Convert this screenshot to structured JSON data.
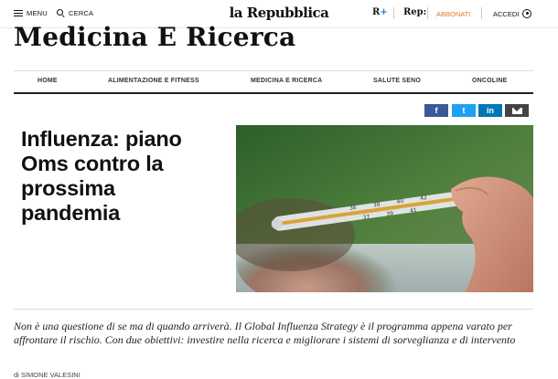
{
  "topbar": {
    "menu_label": "MENU",
    "search_label": "CERCA",
    "logo_text": "la Repubblica",
    "rplus_r": "R",
    "rplus_plus": "+",
    "rep_label": "Rep:",
    "subscribe_label": "ABBONATI",
    "login_label": "ACCEDI"
  },
  "section": {
    "title": "Medicina E Ricerca"
  },
  "nav": {
    "items": [
      {
        "label": "HOME"
      },
      {
        "label": "ALIMENTAZIONE E FITNESS"
      },
      {
        "label": "MEDICINA E RICERCA"
      },
      {
        "label": "SALUTE SENO"
      },
      {
        "label": "ONCOLINE"
      }
    ]
  },
  "share": {
    "facebook": "f",
    "twitter": "t",
    "linkedin": "in"
  },
  "article": {
    "headline": "Influenza: piano Oms contro la prossima pandemia",
    "summary": "Non è una questione di se ma di quando arriverà. Il Global Influenza Strategy è il programma appena varato per affrontare il rischio. Con due obiettivi: investire nella ricerca e migliorare i sistemi di sorveglianza e di intervento",
    "byline": "di SIMONE VALESINI",
    "thermometer_scale": [
      "36",
      "38",
      "40",
      "42",
      "37",
      "39",
      "41"
    ]
  },
  "colors": {
    "accent_subscribe": "#e07a26",
    "facebook": "#3b5998",
    "twitter": "#1da1f2",
    "linkedin": "#0077b5",
    "mail": "#444444"
  },
  "icons": [
    "hamburger-menu-icon",
    "search-icon",
    "user-icon",
    "mail-icon"
  ]
}
